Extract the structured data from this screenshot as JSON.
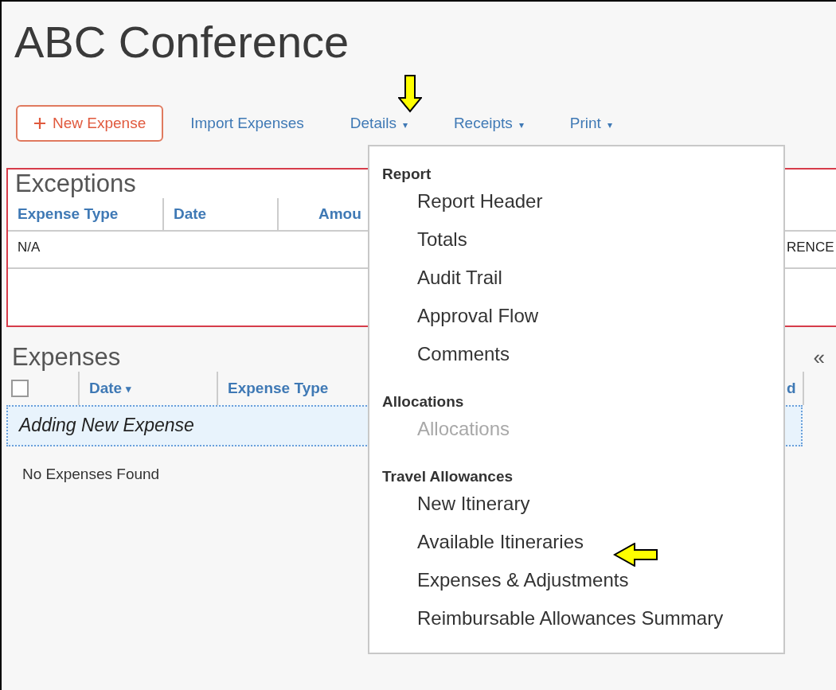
{
  "title": "ABC Conference",
  "toolbar": {
    "new_button": "New Expense",
    "links": [
      {
        "label": "Import Expenses"
      },
      {
        "label": "Details",
        "caret": "▾"
      },
      {
        "label": "Receipts",
        "caret": "▾"
      },
      {
        "label": "Print",
        "caret": "▾"
      }
    ]
  },
  "exceptions": {
    "heading": "Exceptions",
    "columns": [
      "Expense Type",
      "Date",
      "Amou"
    ],
    "rows": [
      {
        "cells": [
          "N/A"
        ],
        "column_cut": "RENCE"
      }
    ]
  },
  "expenses": {
    "heading": "Expenses",
    "collapse": "«",
    "select_all": {
      "checked": false
    },
    "columns": [
      {
        "label": "Date",
        "sort": "▾"
      },
      {
        "label": "Expense Type"
      }
    ],
    "column_cut": "d",
    "new_row": "Adding New Expense",
    "empty": "No Expenses Found"
  },
  "menu": {
    "sections": [
      {
        "heading": "Report",
        "items": [
          {
            "label": "Report Header",
            "disabled": false
          },
          {
            "label": "Totals",
            "disabled": false
          },
          {
            "label": "Audit Trail",
            "disabled": false
          },
          {
            "label": "Approval Flow",
            "disabled": false
          },
          {
            "label": "Comments",
            "disabled": false
          }
        ]
      },
      {
        "heading": "Allocations",
        "items": [
          {
            "label": "Allocations",
            "disabled": true
          }
        ]
      },
      {
        "heading": "Travel Allowances",
        "items": [
          {
            "label": "New Itinerary",
            "disabled": false
          },
          {
            "label": "Available Itineraries",
            "disabled": false
          },
          {
            "label": "Expenses & Adjustments",
            "disabled": false
          },
          {
            "label": "Reimbursable Allowances Summary",
            "disabled": false
          }
        ]
      }
    ]
  }
}
